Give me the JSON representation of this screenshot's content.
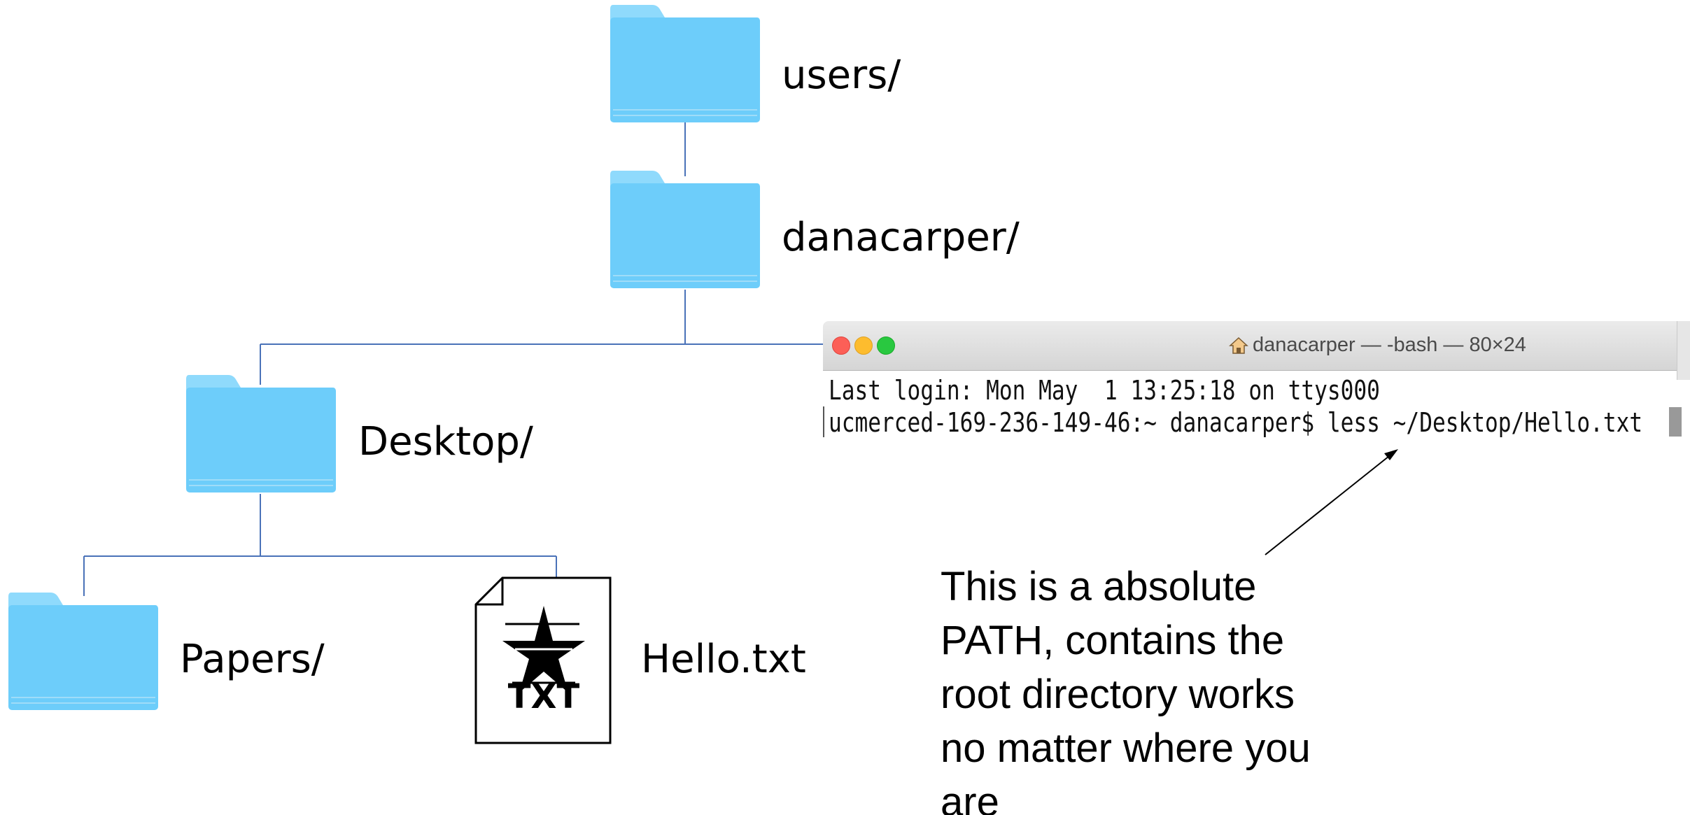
{
  "tree": {
    "users_label": "users/",
    "danacarper_label": "danacarper/",
    "desktop_label": "Desktop/",
    "papers_label": "Papers/",
    "hello_label": "Hello.txt",
    "file_icon_text": "TXT"
  },
  "terminal": {
    "title": "danacarper — -bash — 80×24",
    "line1": "Last login: Mon May  1 13:25:18 on ttys000",
    "line2": "ucmerced-169-236-149-46:~ danacarper$ less ~/Desktop/Hello.txt"
  },
  "note": {
    "lines": [
      "This is a absolute",
      "PATH, contains the",
      "root directory works",
      "no matter where you",
      "are"
    ]
  },
  "colors": {
    "folder_body": "#6dcdfa",
    "folder_tab": "#8fdafc",
    "tree_line": "#4a72b8",
    "traffic_red": "#fc5f57",
    "traffic_yellow": "#fdbc2e",
    "traffic_green": "#29c840"
  },
  "icons": {
    "folder": "folder-icon",
    "txt_file": "txt-file-icon",
    "home": "home-icon"
  }
}
